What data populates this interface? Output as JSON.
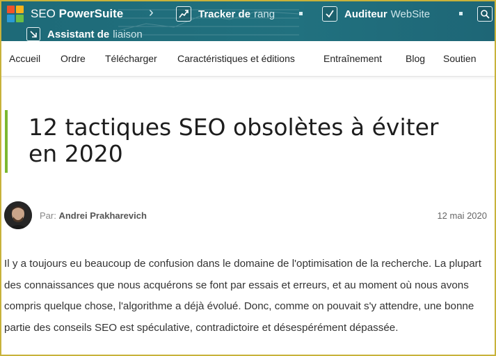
{
  "header": {
    "brand_prefix": "SEO ",
    "brand_bold": "PowerSuite",
    "nav": [
      {
        "bold": "Tracker de",
        "light": "rang",
        "icon": "rank-tracker-icon"
      },
      {
        "bold": "Auditeur",
        "light": "WebSite",
        "icon": "website-auditor-icon"
      },
      {
        "bold": "Assistant de",
        "light": "liaison",
        "icon": "link-assistant-icon"
      }
    ],
    "search_icon": "search-icon"
  },
  "subnav": {
    "items": [
      "Accueil",
      "Ordre",
      "Télécharger",
      "Caractéristiques et éditions",
      "Entraînement",
      "Blog",
      "Soutien"
    ]
  },
  "article": {
    "title": "12 tactiques SEO obsolètes à éviter en 2020",
    "byline_prefix": "Par:",
    "author": "Andrei Prakharevich",
    "date": "12 mai 2020",
    "paragraph": "Il y a toujours eu beaucoup de confusion dans le domaine de l'optimisation de la recherche. La plupart des connaissances que nous acquérons se font par essais et erreurs, et au moment où nous avons compris quelque chose, l'algorithme a déjà évolué. Donc, comme on pouvait s'y attendre, une bonne partie des conseils SEO est spéculative, contradictoire et désespérément dépassée."
  },
  "colors": {
    "header_bg": "#1f6e7e",
    "accent_green": "#7cb82f",
    "frame": "#c8b23a"
  }
}
